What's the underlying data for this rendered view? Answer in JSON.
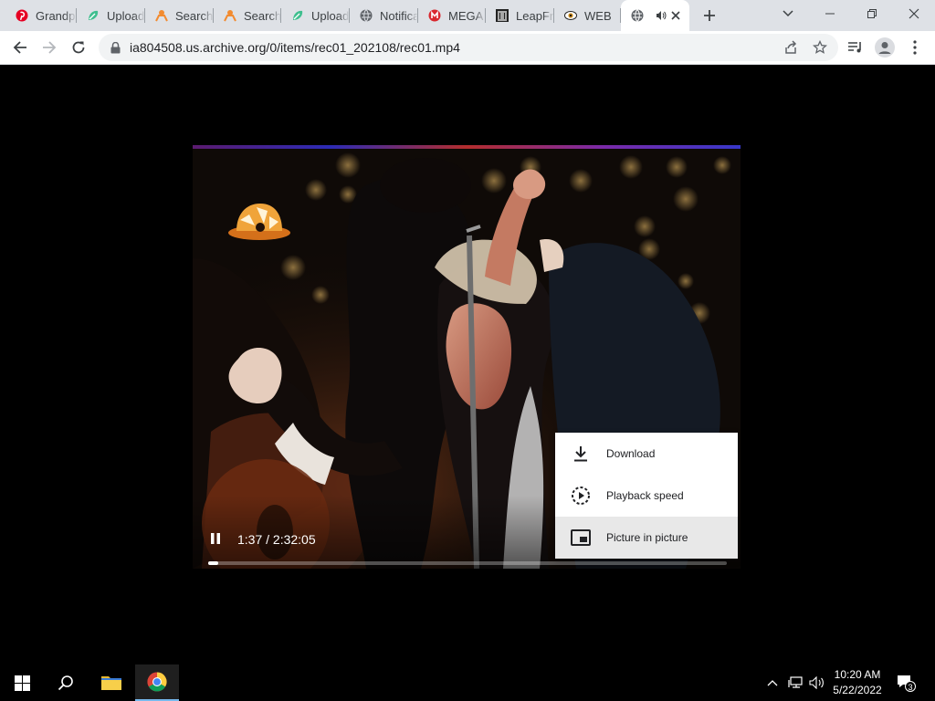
{
  "tabs": [
    {
      "title": "Grandp",
      "icon": "pin-icon"
    },
    {
      "title": "Uploads",
      "icon": "leaf-icon"
    },
    {
      "title": "Search",
      "icon": "person-icon"
    },
    {
      "title": "Search",
      "icon": "person-icon"
    },
    {
      "title": "Uploads",
      "icon": "leaf-icon"
    },
    {
      "title": "Notifica",
      "icon": "globe-icon"
    },
    {
      "title": "MEGA",
      "icon": "mega-icon"
    },
    {
      "title": "LeapFr",
      "icon": "columns-icon"
    },
    {
      "title": "WEB",
      "icon": "eye-icon"
    },
    {
      "title": "",
      "icon": "globe-icon",
      "active": true
    }
  ],
  "toolbar": {
    "url": "ia804508.us.archive.org/0/items/rec01_202108/rec01.mp4"
  },
  "player": {
    "timecode": "1:37 / 2:32:05",
    "progress": 0.011
  },
  "menu": {
    "items": [
      {
        "label": "Download",
        "icon": "download-icon"
      },
      {
        "label": "Playback speed",
        "icon": "playback-speed-icon"
      },
      {
        "label": "Picture in picture",
        "icon": "picture-in-picture-icon",
        "hover": true
      }
    ]
  },
  "taskbar": {
    "time": "10:20 AM",
    "date": "5/22/2022",
    "notifications": "3"
  },
  "colors": {
    "tabstrip": "#dee1e6",
    "accent": "#76b9ed"
  }
}
